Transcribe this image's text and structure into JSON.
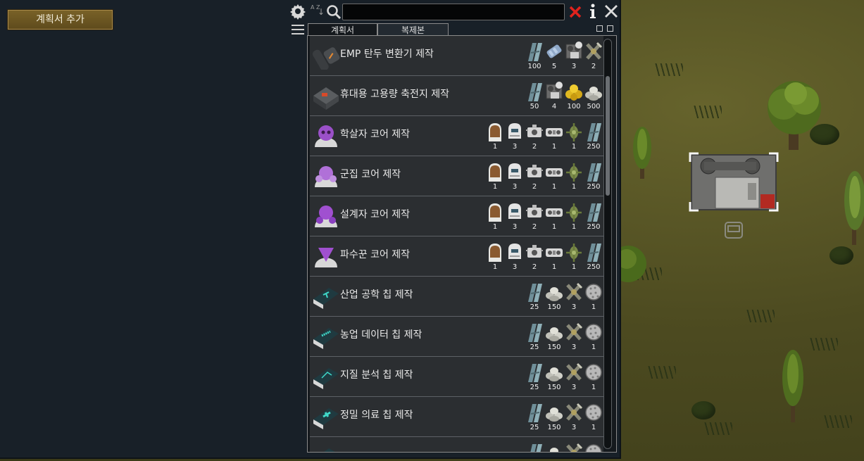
{
  "toolbar": {
    "add_plan_label": "계획서 추가",
    "search_value": "",
    "sort_icon_text": "A Z"
  },
  "tabs": [
    {
      "label": "계획서",
      "active": true
    },
    {
      "label": "복제본",
      "active": false
    }
  ],
  "recipes": [
    {
      "name": "EMP 탄두 변환기 제작",
      "icon": "emp-converter-icon",
      "ingredients": [
        {
          "icon": "plasteel-icon",
          "count": "100"
        },
        {
          "icon": "advanced-component-icon",
          "count": "5"
        },
        {
          "icon": "tape-drive-icon",
          "count": "3"
        },
        {
          "icon": "broken-part-icon",
          "count": "2"
        }
      ]
    },
    {
      "name": "휴대용 고용량 축전지 제작",
      "icon": "battery-icon",
      "ingredients": [
        {
          "icon": "plasteel-icon",
          "count": "50"
        },
        {
          "icon": "tape-drive-icon",
          "count": "4"
        },
        {
          "icon": "gold-icon",
          "count": "100"
        },
        {
          "icon": "silver-icon",
          "count": "500"
        }
      ]
    },
    {
      "name": "학살자 코어 제작",
      "icon": "slaughter-core-icon",
      "ingredients": [
        {
          "icon": "brain-jar-icon",
          "count": "1"
        },
        {
          "icon": "helmet-icon",
          "count": "3"
        },
        {
          "icon": "gear-part-icon",
          "count": "2"
        },
        {
          "icon": "film-reel-icon",
          "count": "1"
        },
        {
          "icon": "drone-part-icon",
          "count": "1"
        },
        {
          "icon": "plasteel-icon",
          "count": "250"
        }
      ]
    },
    {
      "name": "군집 코어 제작",
      "icon": "swarm-core-icon",
      "ingredients": [
        {
          "icon": "brain-jar-icon",
          "count": "1"
        },
        {
          "icon": "helmet-icon",
          "count": "3"
        },
        {
          "icon": "gear-part-icon",
          "count": "2"
        },
        {
          "icon": "film-reel-icon",
          "count": "1"
        },
        {
          "icon": "drone-part-icon",
          "count": "1"
        },
        {
          "icon": "plasteel-icon",
          "count": "250"
        }
      ]
    },
    {
      "name": "설계자 코어 제작",
      "icon": "designer-core-icon",
      "ingredients": [
        {
          "icon": "brain-jar-icon",
          "count": "1"
        },
        {
          "icon": "helmet-icon",
          "count": "3"
        },
        {
          "icon": "gear-part-icon",
          "count": "2"
        },
        {
          "icon": "film-reel-icon",
          "count": "1"
        },
        {
          "icon": "drone-part-icon",
          "count": "1"
        },
        {
          "icon": "plasteel-icon",
          "count": "250"
        }
      ]
    },
    {
      "name": "파수꾼 코어 제작",
      "icon": "sentinel-core-icon",
      "ingredients": [
        {
          "icon": "brain-jar-icon",
          "count": "1"
        },
        {
          "icon": "helmet-icon",
          "count": "3"
        },
        {
          "icon": "gear-part-icon",
          "count": "2"
        },
        {
          "icon": "film-reel-icon",
          "count": "1"
        },
        {
          "icon": "drone-part-icon",
          "count": "1"
        },
        {
          "icon": "plasteel-icon",
          "count": "250"
        }
      ]
    },
    {
      "name": "산업 공학 칩 제작",
      "icon": "chip-industry-icon",
      "ingredients": [
        {
          "icon": "plasteel-icon",
          "count": "25"
        },
        {
          "icon": "silver-icon",
          "count": "150"
        },
        {
          "icon": "broken-part-icon",
          "count": "3"
        },
        {
          "icon": "sphere-icon",
          "count": "1"
        }
      ]
    },
    {
      "name": "농업 데이터 칩 제작",
      "icon": "chip-agriculture-icon",
      "ingredients": [
        {
          "icon": "plasteel-icon",
          "count": "25"
        },
        {
          "icon": "silver-icon",
          "count": "150"
        },
        {
          "icon": "broken-part-icon",
          "count": "3"
        },
        {
          "icon": "sphere-icon",
          "count": "1"
        }
      ]
    },
    {
      "name": "지질 분석 칩 제작",
      "icon": "chip-geology-icon",
      "ingredients": [
        {
          "icon": "plasteel-icon",
          "count": "25"
        },
        {
          "icon": "silver-icon",
          "count": "150"
        },
        {
          "icon": "broken-part-icon",
          "count": "3"
        },
        {
          "icon": "sphere-icon",
          "count": "1"
        }
      ]
    },
    {
      "name": "정밀 의료 칩 제작",
      "icon": "chip-medical-icon",
      "ingredients": [
        {
          "icon": "plasteel-icon",
          "count": "25"
        },
        {
          "icon": "silver-icon",
          "count": "150"
        },
        {
          "icon": "broken-part-icon",
          "count": "3"
        },
        {
          "icon": "sphere-icon",
          "count": "1"
        }
      ]
    },
    {
      "name": "",
      "icon": "chip-partial-icon",
      "ingredients": [
        {
          "icon": "plasteel-icon",
          "count": ""
        },
        {
          "icon": "silver-icon",
          "count": ""
        },
        {
          "icon": "broken-part-icon",
          "count": ""
        },
        {
          "icon": "sphere-icon",
          "count": ""
        }
      ]
    }
  ],
  "colors": {
    "panel_bg": "#182028",
    "row_bg": "#2b2e31",
    "button_gold": "#7a6228",
    "close_red": "#e0231d",
    "map_green": "#4c4a20"
  }
}
